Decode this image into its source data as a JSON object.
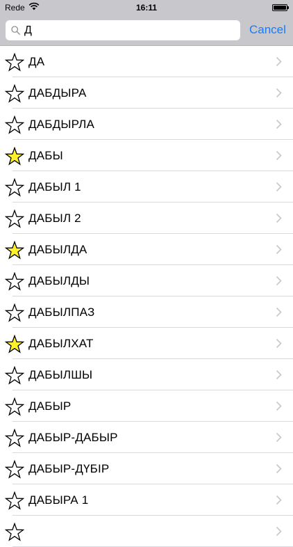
{
  "status_bar": {
    "carrier": "Rede",
    "time": "16:11"
  },
  "search": {
    "value": "Д",
    "cancel_label": "Cancel"
  },
  "colors": {
    "accent": "#1a7cf7",
    "favorite_star": "#fff22a",
    "empty_star": "#ffffff"
  },
  "rows": [
    {
      "label": "ДА",
      "favorite": false
    },
    {
      "label": "ДАБДЫРА",
      "favorite": false
    },
    {
      "label": "ДАБДЫРЛА",
      "favorite": false
    },
    {
      "label": "ДАБЫ",
      "favorite": true
    },
    {
      "label": "ДАБЫЛ 1",
      "favorite": false
    },
    {
      "label": "ДАБЫЛ 2",
      "favorite": false
    },
    {
      "label": "ДАБЫЛДА",
      "favorite": true
    },
    {
      "label": "ДАБЫЛДЫ",
      "favorite": false
    },
    {
      "label": "ДАБЫЛПАЗ",
      "favorite": false
    },
    {
      "label": "ДАБЫЛХАТ",
      "favorite": true
    },
    {
      "label": "ДАБЫЛШЫ",
      "favorite": false
    },
    {
      "label": "ДАБЫР",
      "favorite": false
    },
    {
      "label": "ДАБЫР-ДАБЫР",
      "favorite": false
    },
    {
      "label": "ДАБЫР-ДҮБІР",
      "favorite": false
    },
    {
      "label": "ДАБЫРА 1",
      "favorite": false
    },
    {
      "label": "",
      "favorite": false
    }
  ]
}
